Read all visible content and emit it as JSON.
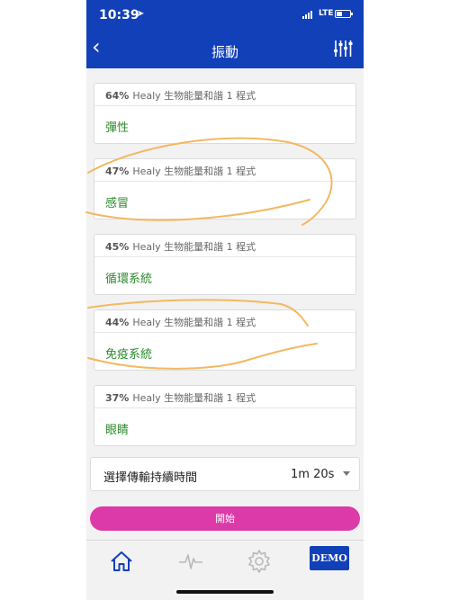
{
  "status": {
    "time": "10:39",
    "network": "LTE"
  },
  "nav": {
    "title": "振動"
  },
  "items": [
    {
      "pct": "64%",
      "program": "Healy 生物能量和諧 1 程式",
      "name": "彈性"
    },
    {
      "pct": "47%",
      "program": "Healy 生物能量和諧 1 程式",
      "name": "感冒"
    },
    {
      "pct": "45%",
      "program": "Healy 生物能量和諧 1 程式",
      "name": "循環系統"
    },
    {
      "pct": "44%",
      "program": "Healy 生物能量和諧 1 程式",
      "name": "免疫系統"
    },
    {
      "pct": "37%",
      "program": "Healy 生物能量和諧 1 程式",
      "name": "眼睛"
    }
  ],
  "duration": {
    "label": "選擇傳輸持續時間",
    "value": "1m 20s"
  },
  "start_label": "開始",
  "tabs": {
    "demo_label": "DEMO"
  },
  "colors": {
    "header": "#1140b8",
    "accent": "#dc3aa8",
    "item_name": "#2a8a2a",
    "annotation": "#f3b860"
  }
}
